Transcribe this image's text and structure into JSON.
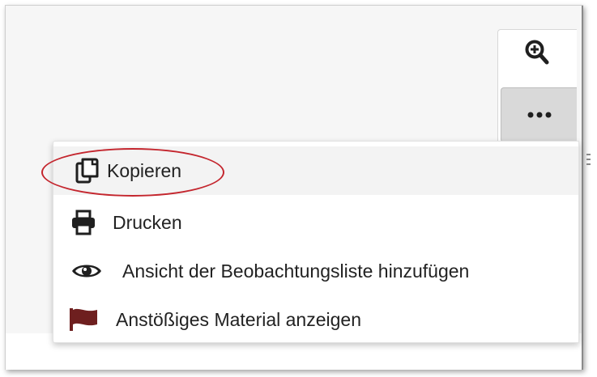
{
  "toolbar": {
    "zoom_icon": "zoom-in-icon",
    "more_icon": "ellipsis-icon"
  },
  "menu": {
    "items": [
      {
        "label": "Kopieren",
        "icon": "copy-icon"
      },
      {
        "label": "Drucken",
        "icon": "print-icon"
      },
      {
        "label": "Ansicht der Beobachtungsliste hinzufügen",
        "icon": "eye-icon"
      },
      {
        "label": "Anstößiges Material anzeigen",
        "icon": "flag-icon"
      }
    ]
  },
  "colors": {
    "highlight": "#c4262e",
    "flag": "#6e1f1f",
    "icon": "#1f1f1f",
    "active_item_bg": "#f3f3f3"
  }
}
